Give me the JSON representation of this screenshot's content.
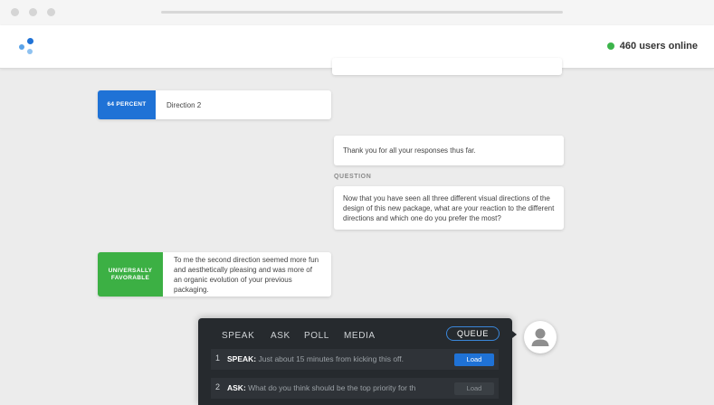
{
  "header": {
    "online_text": "460 users online",
    "online_color": "#3cb44b",
    "logo_colors": [
      "#1f72d6",
      "#5aa3e8",
      "#8fc2f0"
    ]
  },
  "responses": [
    {
      "badge": "64 PERCENT",
      "badge_color": "#1f72d6",
      "text": "Direction 2"
    },
    {
      "badge": "UNIVERSALLY FAVORABLE",
      "badge_color": "#3cb044",
      "text": "To me the second direction seemed more fun and aesthetically pleasing and was more of an organic evolution of your previous packaging."
    }
  ],
  "messages": [
    {
      "text": "Thank you for all your responses thus far."
    },
    {
      "label": "QUESTION",
      "text": "Now that you have seen all three different visual directions of the design of this new package, what are your reaction to the different directions and which one do you prefer the most?"
    }
  ],
  "panel": {
    "tabs": [
      "SPEAK",
      "ASK",
      "POLL",
      "MEDIA"
    ],
    "queue_label": "QUEUE",
    "items": [
      {
        "num": "1",
        "kind": "SPEAK:",
        "text": "Just about 15 minutes from kicking this off.",
        "button": "Load"
      },
      {
        "num": "2",
        "kind": "ASK:",
        "text": "What do you think should be the top priority for th",
        "button": "Load"
      }
    ]
  },
  "icons": {
    "avatar": "user-avatar-icon",
    "logo": "app-logo-icon"
  }
}
